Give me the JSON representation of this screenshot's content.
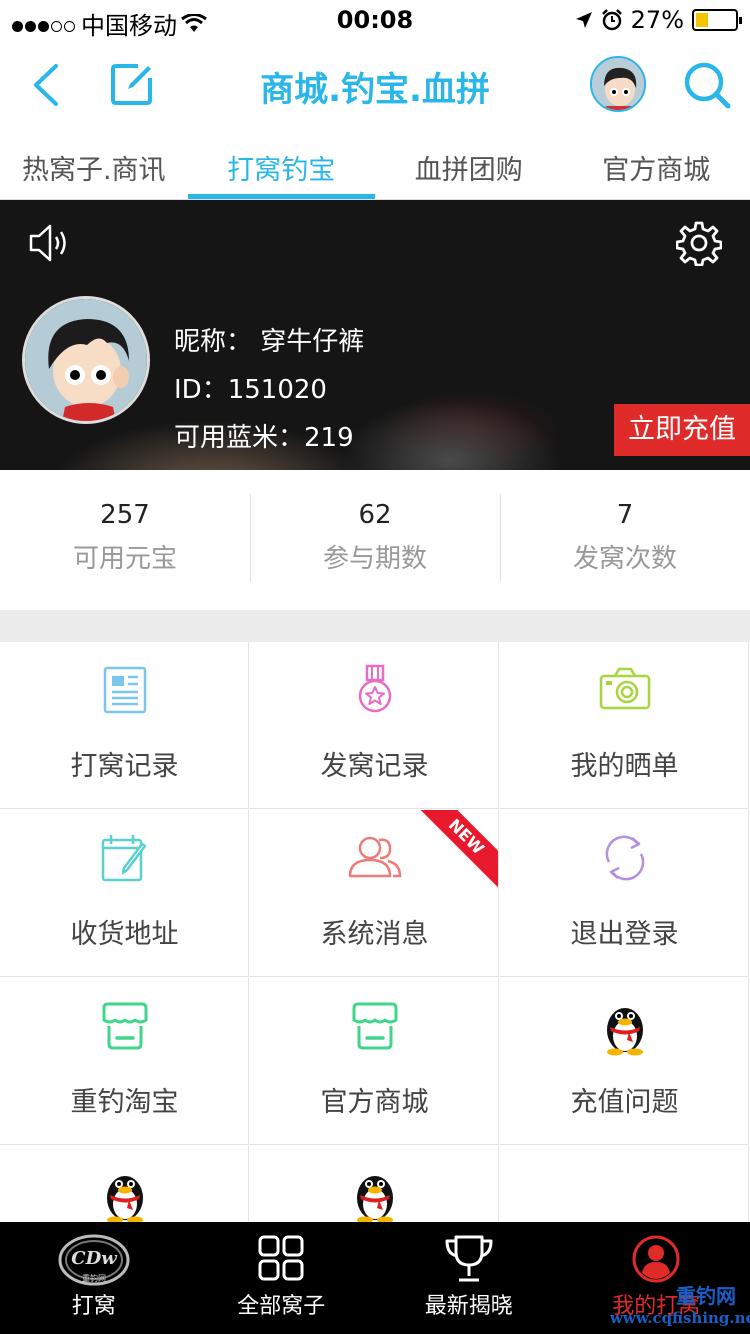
{
  "status_bar": {
    "carrier": "中国移动",
    "time": "00:08",
    "battery": "27%"
  },
  "nav": {
    "title": "商城.钓宝.血拼"
  },
  "tabs": [
    {
      "label": "热窝子.商讯"
    },
    {
      "label": "打窝钓宝",
      "active": true
    },
    {
      "label": "血拼团购"
    },
    {
      "label": "官方商城"
    }
  ],
  "profile": {
    "nickname": "昵称：  穿牛仔裤",
    "id": "ID：151020",
    "balance": "可用蓝米：219",
    "recharge_label": "立即充值"
  },
  "stats": [
    {
      "value": "257",
      "label": "可用元宝"
    },
    {
      "value": "62",
      "label": "参与期数"
    },
    {
      "value": "7",
      "label": "发窝次数"
    }
  ],
  "grid": [
    {
      "label": "打窝记录",
      "icon": "document-icon",
      "color": "#7cc6ee"
    },
    {
      "label": "发窝记录",
      "icon": "medal-icon",
      "color": "#e86bc4"
    },
    {
      "label": "我的晒单",
      "icon": "camera-icon",
      "color": "#a6d63c"
    },
    {
      "label": "收货地址",
      "icon": "calendar-edit-icon",
      "color": "#5cd0d0"
    },
    {
      "label": "系统消息",
      "icon": "users-icon",
      "color": "#ee7a7a",
      "badge": "NEW"
    },
    {
      "label": "退出登录",
      "icon": "refresh-icon",
      "color": "#b48ee0"
    },
    {
      "label": "重钓淘宝",
      "icon": "store-icon",
      "color": "#3fd68a"
    },
    {
      "label": "官方商城",
      "icon": "store-icon",
      "color": "#3fd68a"
    },
    {
      "label": "充值问题",
      "icon": "qq-penguin-icon"
    },
    {
      "label": "",
      "icon": "qq-penguin-icon"
    },
    {
      "label": "",
      "icon": "qq-penguin-icon"
    }
  ],
  "tabbar": [
    {
      "label": "打窝",
      "icon": "cdw-logo-icon"
    },
    {
      "label": "全部窝子",
      "icon": "grid-icon"
    },
    {
      "label": "最新揭晓",
      "icon": "trophy-icon"
    },
    {
      "label": "我的打窝",
      "icon": "user-icon",
      "active": true
    }
  ],
  "watermark": {
    "brand": "重钓网",
    "url": "www.cqfishing.net"
  },
  "colors": {
    "accent": "#29b6e8",
    "recharge": "#e02b2b",
    "badge": "#e8192c"
  }
}
